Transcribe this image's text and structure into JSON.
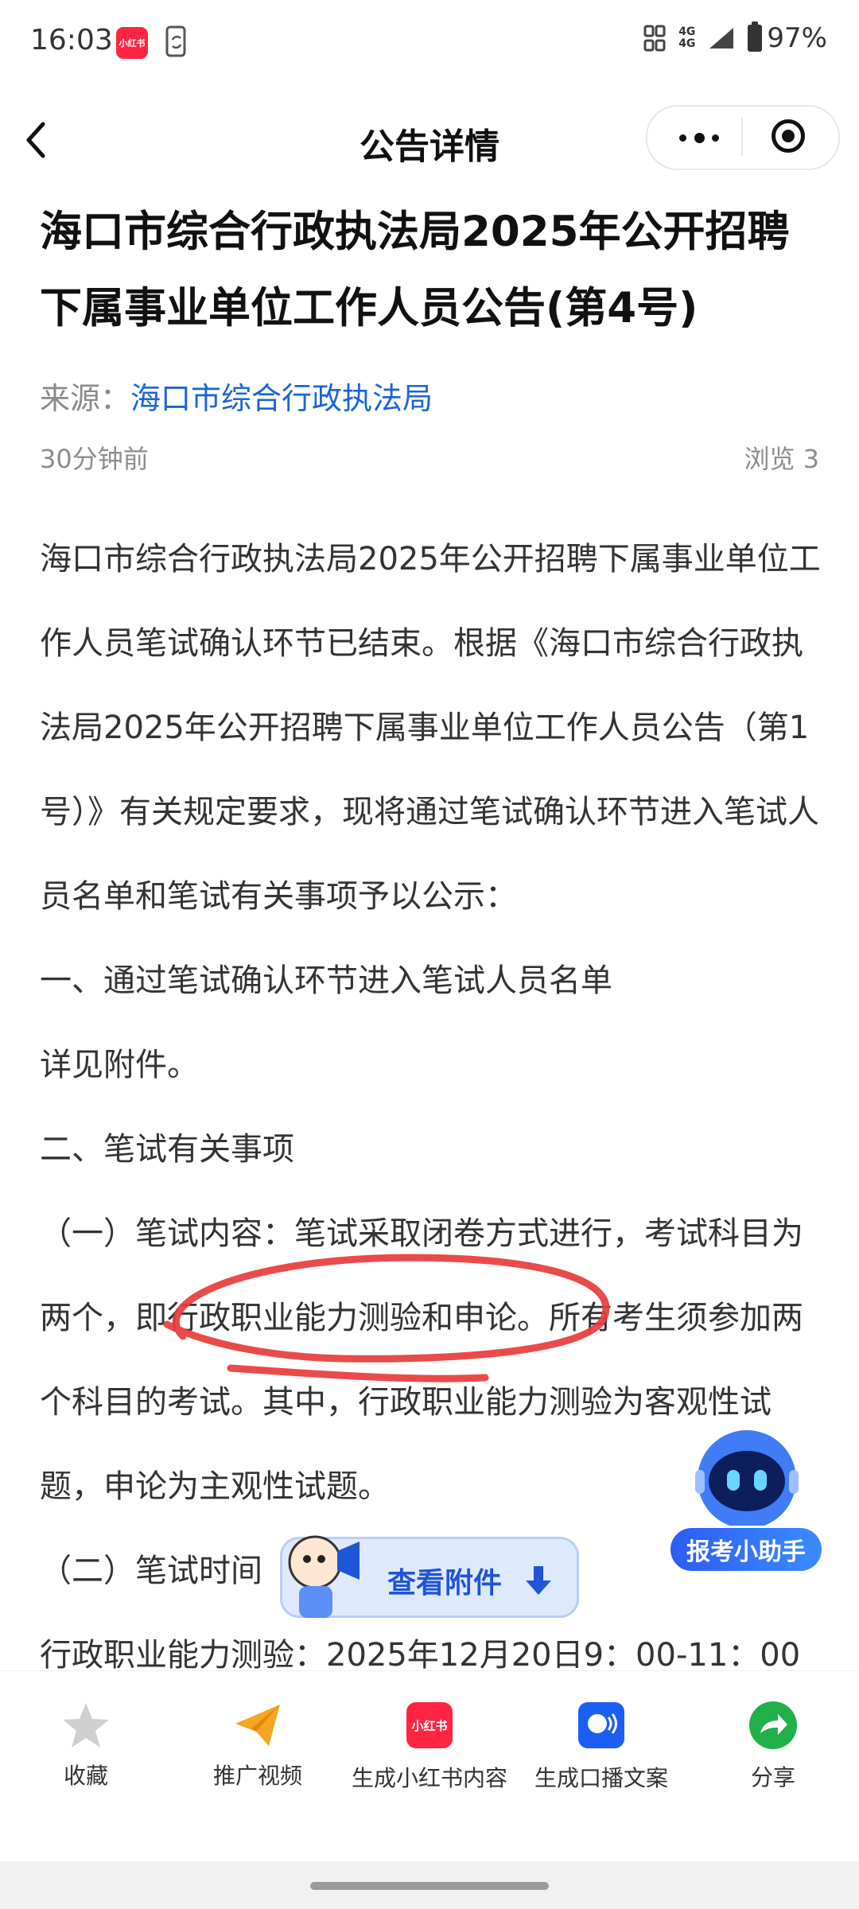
{
  "status_bar": {
    "time": "16:03",
    "app_badge": "小红书",
    "network": "4G",
    "battery": "97%"
  },
  "header": {
    "title": "公告详情"
  },
  "article": {
    "title": "海口市综合行政执法局2025年公开招聘下属事业单位工作人员公告(第4号)",
    "source_label": "来源：",
    "source_value": "海口市综合行政执法局",
    "time_ago": "30分钟前",
    "views": "浏览 3",
    "paragraphs": [
      "海口市综合行政执法局2025年公开招聘下属事业单位工作人员笔试确认环节已结束。根据《海口市综合行政执法局2025年公开招聘下属事业单位工作人员公告（第1号）》有关规定要求，现将通过笔试确认环节进入笔试人员名单和笔试有关事项予以公示：",
      "一、通过笔试确认环节进入笔试人员名单",
      "详见附件。",
      "二、笔试有关事项",
      "（一）笔试内容：笔试采取闭卷方式进行，考试科目为两个，即行政职业能力测验和申论。所有考生须参加两个科目的考试。其中，行政职业能力测验为客观性试题，申论为主观性试题。",
      "（二）笔试时间",
      "行政职业能力测验：2025年12月20日9：00-11：00"
    ]
  },
  "floating": {
    "assistant_label": "报考小助手",
    "attachment_label": "查看附件"
  },
  "toolbar": {
    "items": [
      {
        "label": "收藏",
        "icon": "star-icon"
      },
      {
        "label": "推广视频",
        "icon": "paper-plane-icon"
      },
      {
        "label": "生成小红书内容",
        "icon": "xiaohongshu-icon"
      },
      {
        "label": "生成口播文案",
        "icon": "voice-icon"
      },
      {
        "label": "分享",
        "icon": "share-icon"
      }
    ]
  },
  "colors": {
    "link": "#1a66d9",
    "marker": "#e83b3b",
    "accent": "#1f55d6"
  }
}
